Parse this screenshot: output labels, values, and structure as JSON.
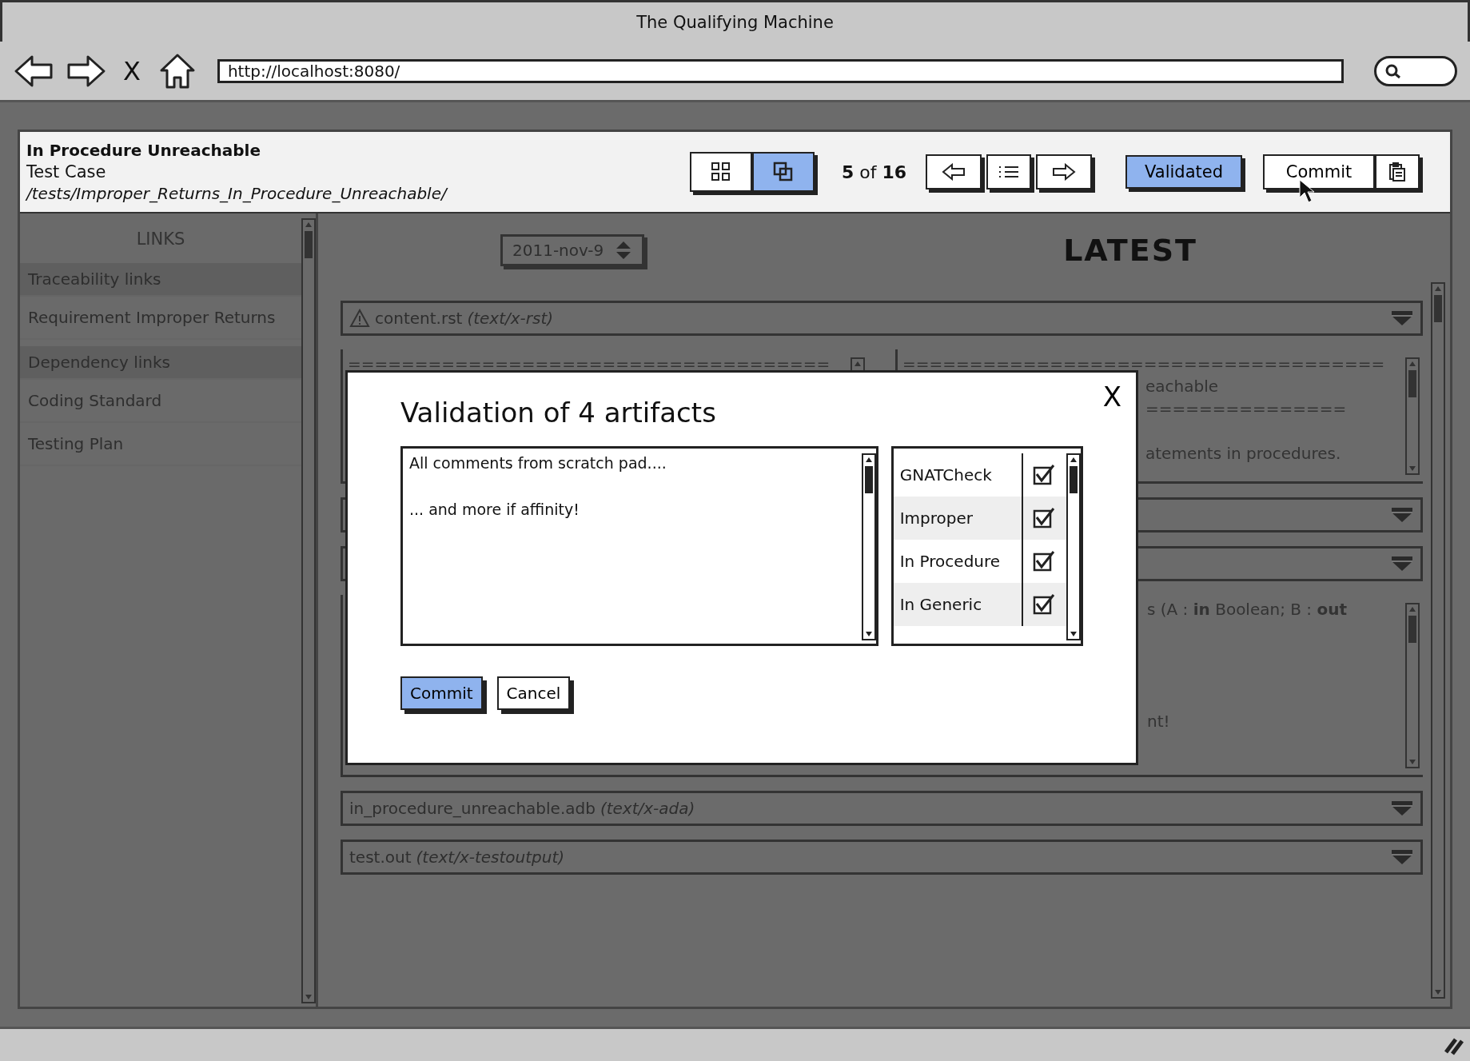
{
  "browser": {
    "title": "The Qualifying Machine",
    "stop": "X",
    "url": "http://localhost:8080/"
  },
  "header": {
    "title": "In Procedure Unreachable",
    "subtitle": "Test Case",
    "path": "/tests/Improper_Returns_In_Procedure_Unreachable/",
    "views": [
      {
        "selected": false
      },
      {
        "selected": true
      }
    ],
    "counter": "**5** of **16**",
    "validated": {
      "label": "Validated",
      "selected": true
    },
    "commit": "Commit"
  },
  "sidebar": {
    "title": "LINKS",
    "items": [
      {
        "label": "Traceability links",
        "kind": "group"
      },
      {
        "label": "Requirement Improper Returns",
        "kind": "item"
      },
      {
        "label": "Dependency links",
        "kind": "group"
      },
      {
        "label": "Coding Standard",
        "kind": "item"
      },
      {
        "label": "Testing Plan",
        "kind": "item"
      }
    ]
  },
  "date": "2011-nov-9",
  "heading": "LATEST",
  "sections": [
    {
      "kind": "header",
      "warning": true,
      "file": "content.rst",
      "mime": "(text/x-rst)"
    },
    {
      "kind": "split",
      "left": [
        {
          "kind": "full",
          "text": "===================================="
        }
      ],
      "right": [
        {
          "kind": "full",
          "text": "===================================="
        },
        {
          "kind": "cut",
          "text": "eachable"
        },
        {
          "kind": "cut",
          "text": "==============="
        },
        {
          "kind": "blank"
        },
        {
          "kind": "cut",
          "text": "atements in procedures."
        }
      ]
    },
    {
      "kind": "header"
    },
    {
      "kind": "header"
    },
    {
      "kind": "pane",
      "lines": [
        {
          "kind": "cut",
          "text": "s (A : **in** Boolean; B : **out**"
        },
        {
          "kind": "blank"
        },
        {
          "kind": "blank"
        },
        {
          "kind": "blank"
        },
        {
          "kind": "blank"
        },
        {
          "kind": "cut",
          "text": "nt!"
        }
      ]
    },
    {
      "kind": "header",
      "warning": false,
      "file": "in_procedure_unreachable.adb",
      "mime": "(text/x-ada)"
    },
    {
      "kind": "header",
      "warning": false,
      "file": "test.out",
      "mime": "(text/x-testoutput)"
    }
  ],
  "dialog": {
    "close": "X",
    "title": "Validation of 4 artifacts",
    "comment": "All comments from scratch pad....\n\n... and more if affinity!",
    "artifacts": [
      {
        "label": "GNATCheck",
        "checked": true
      },
      {
        "label": "Improper",
        "checked": true
      },
      {
        "label": "In Procedure",
        "checked": true
      },
      {
        "label": "In Generic",
        "checked": true
      }
    ],
    "buttons": [
      {
        "label": "Commit",
        "kind": "primary"
      },
      {
        "label": "Cancel",
        "kind": "secondary"
      }
    ]
  }
}
